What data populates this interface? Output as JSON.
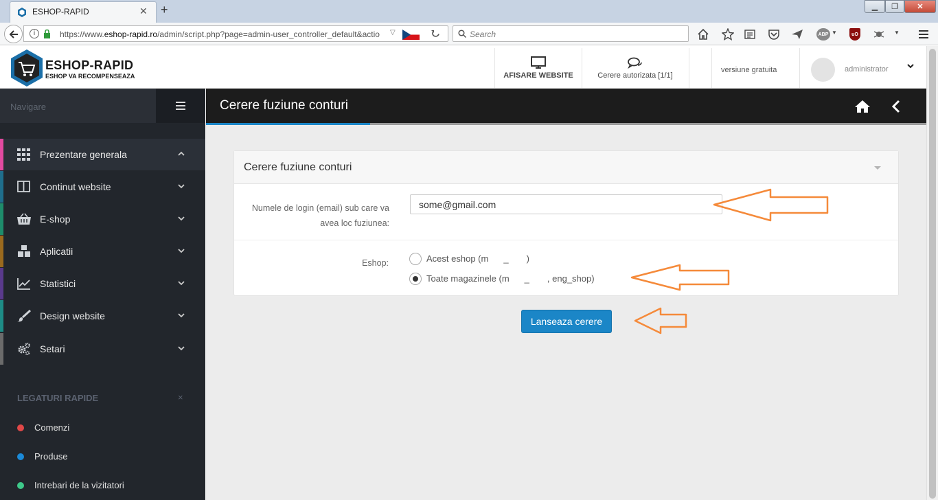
{
  "browser": {
    "tab_title": "ESHOP-RAPID",
    "url_prefix": "https://www.",
    "url_domain": "eshop-rapid.ro",
    "url_path": "/admin/script.php?page=admin-user_controller_default&actio",
    "search_placeholder": "Search",
    "icons": [
      "back-arrow-icon",
      "info-icon",
      "lock-icon",
      "dropdown-icon",
      "flag-cz-icon",
      "reload-icon",
      "search-icon",
      "home-icon",
      "star-icon",
      "reading-list-icon",
      "pocket-icon",
      "send-icon",
      "adblock-icon",
      "ublock-icon",
      "extension-icon",
      "menu-icon"
    ]
  },
  "header": {
    "logo_name": "ESHOP-RAPID",
    "logo_tagline": "ESHOP VA RECOMPENSEAZA",
    "website_label": "AFISARE WEBSITE",
    "requests_label": "Cerere autorizata [1/1]",
    "version_label": "versiune gratuita",
    "user_label": "administrator"
  },
  "sidebar": {
    "nav_label": "Navigare",
    "items": [
      {
        "label": "Prezentare generala",
        "icon": "grid-icon",
        "accent": "#e24aa0",
        "expanded": true
      },
      {
        "label": "Continut website",
        "icon": "columns-icon",
        "accent": "#1f6e8c",
        "expanded": false
      },
      {
        "label": "E-shop",
        "icon": "basket-icon",
        "accent": "#1e8c6b",
        "expanded": false
      },
      {
        "label": "Aplicatii",
        "icon": "cubes-icon",
        "accent": "#9b6a1e",
        "expanded": false
      },
      {
        "label": "Statistici",
        "icon": "chart-icon",
        "accent": "#5a3a8c",
        "expanded": false
      },
      {
        "label": "Design website",
        "icon": "brush-icon",
        "accent": "#1e8c86",
        "expanded": false
      },
      {
        "label": "Setari",
        "icon": "gears-icon",
        "accent": "#6b6b6b",
        "expanded": false
      }
    ],
    "quick_links_title": "LEGATURI RAPIDE",
    "quick_links_close": "×",
    "quick_links": [
      {
        "label": "Comenzi",
        "color": "#e04848"
      },
      {
        "label": "Produse",
        "color": "#1b8ad8"
      },
      {
        "label": "Intrebari de la vizitatori",
        "color": "#3ec98a"
      }
    ]
  },
  "page": {
    "title": "Cerere fuziune conturi",
    "panel_title": "Cerere fuziune conturi",
    "email_label_line1": "Numele de login (email) sub care va",
    "email_label_line2": "avea loc fuziunea:",
    "email_value": "some@gmail.com",
    "eshop_label": "Eshop:",
    "radio_options": [
      {
        "label": "Acest eshop (m",
        "suffix": "_",
        "close": ")",
        "selected": false
      },
      {
        "label": "Toate magazinele (m",
        "suffix": "_",
        "close": ", eng_shop)",
        "selected": true
      }
    ],
    "submit_label": "Lanseaza cerere"
  },
  "colors": {
    "accent_blue": "#1b86c7",
    "annotation_arrow": "#f58a3a",
    "sidebar_bg": "#22262c",
    "page_bar_bg": "#1c1c1c"
  }
}
